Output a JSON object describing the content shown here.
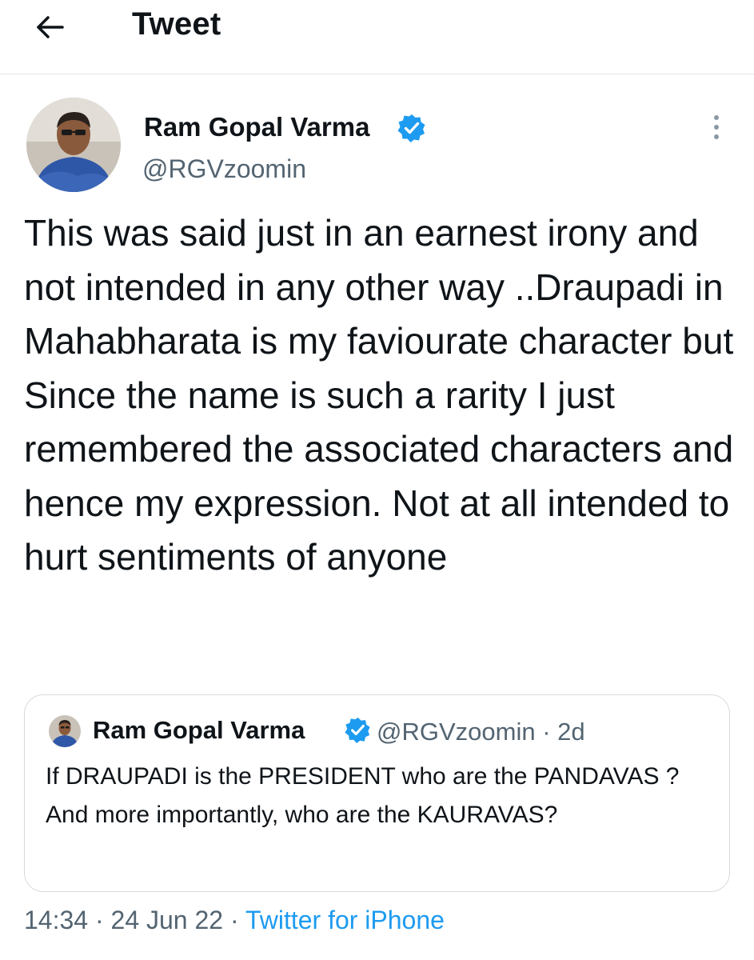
{
  "header": {
    "title": "Tweet",
    "back_icon": "arrow-left-icon"
  },
  "tweet": {
    "author": {
      "name": "Ram Gopal Varma",
      "handle": "@RGVzoomin",
      "verified": true
    },
    "text": "This was said just in an earnest irony and not intended in any other way ..Draupadi in Mahabharata is my faviourate character but Since the name is such a rarity I just remembered the associated characters and hence my expression. Not at all intended to hurt sentiments of anyone",
    "quoted": {
      "name": "Ram Gopal Varma",
      "handle": "@RGVzoomin",
      "age": "2d",
      "separator": "·",
      "text": "If DRAUPADI is the PRESIDENT who are the PANDAVAS ? And more importantly, who are the KAURAVAS?"
    },
    "time": "14:34",
    "date": "24 Jun 22",
    "source": "Twitter for iPhone",
    "separator": "·"
  },
  "colors": {
    "accent": "#1d9bf0",
    "text": "#0f1419",
    "muted": "#536471",
    "border": "#d6dbdf"
  }
}
